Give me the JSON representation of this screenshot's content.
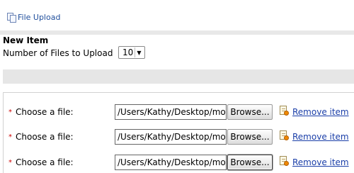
{
  "top_link": {
    "label": "File Upload",
    "icon": "pages-icon"
  },
  "form": {
    "section_title": "New Item",
    "num_files_label": "Number of Files to Upload",
    "num_files_value": "10"
  },
  "files": [
    {
      "required_marker": "*",
      "label": "Choose a file:",
      "path": "/Users/Kathy/Desktop/mo",
      "browse_label": "Browse...",
      "remove_label": "Remove item"
    },
    {
      "required_marker": "*",
      "label": "Choose a file:",
      "path": "/Users/Kathy/Desktop/mo",
      "browse_label": "Browse...",
      "remove_label": "Remove item"
    },
    {
      "required_marker": "*",
      "label": "Choose a file:",
      "path": "/Users/Kathy/Desktop/mo",
      "browse_label": "Browse...",
      "remove_label": "Remove item"
    }
  ],
  "colors": {
    "link": "#1a3ea8",
    "required": "#cc0000",
    "bar": "#e6e6e6"
  }
}
